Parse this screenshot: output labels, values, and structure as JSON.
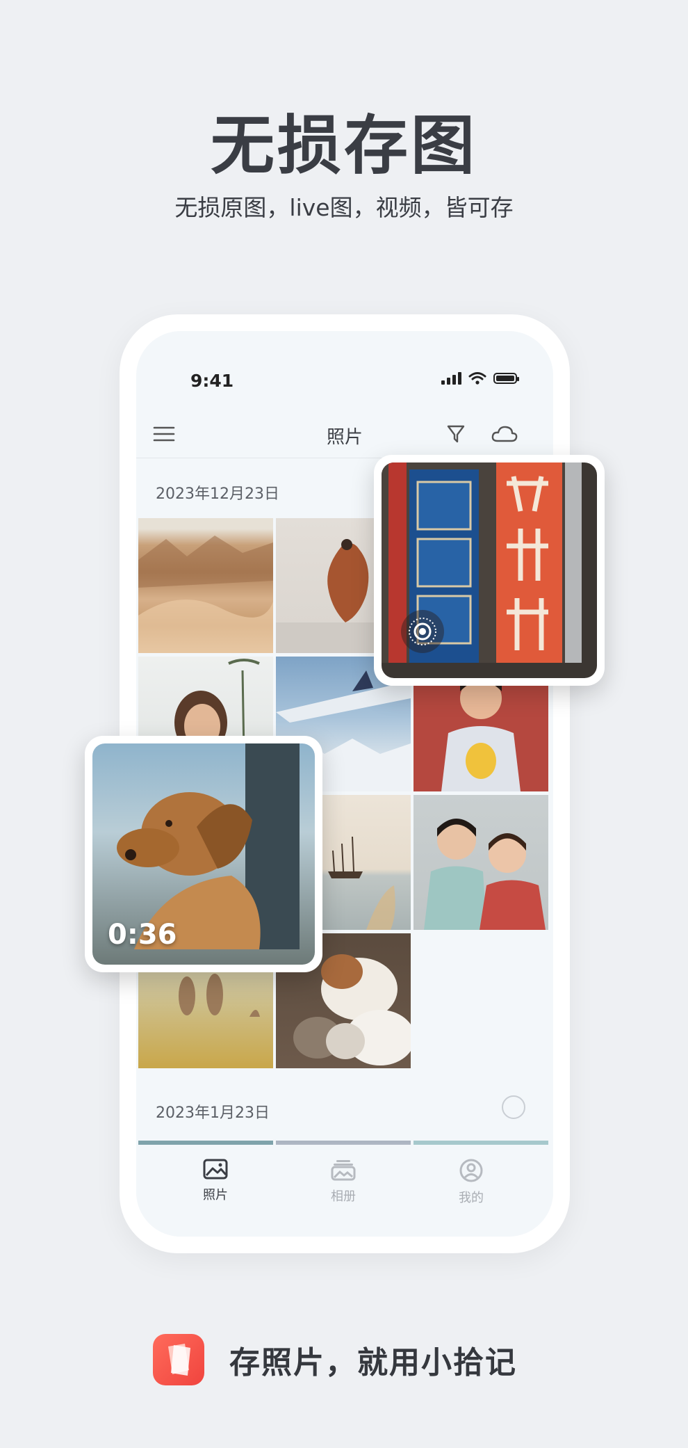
{
  "headline": "无损存图",
  "subhead": "无损原图，live图，视频，皆可存",
  "status": {
    "time": "9:41"
  },
  "appbar": {
    "title": "照片",
    "icons": [
      "menu-icon",
      "filter-icon",
      "cloud-icon"
    ]
  },
  "sections": [
    {
      "date": "2023年12月23日"
    },
    {
      "date": "2023年1月23日"
    }
  ],
  "video_card": {
    "duration": "0:36"
  },
  "live_card": {
    "badge_icon": "live-photo-icon"
  },
  "tabs": [
    {
      "label": "照片",
      "icon": "photo-icon",
      "active": true
    },
    {
      "label": "相册",
      "icon": "album-icon",
      "active": false
    },
    {
      "label": "我的",
      "icon": "profile-icon",
      "active": false
    }
  ],
  "footer": {
    "text": "存照片，就用小拾记",
    "logo_icon": "app-logo-icon"
  },
  "colors": {
    "accent": "#f0443e",
    "background": "#eef0f3",
    "screen": "#f3f7fa"
  }
}
